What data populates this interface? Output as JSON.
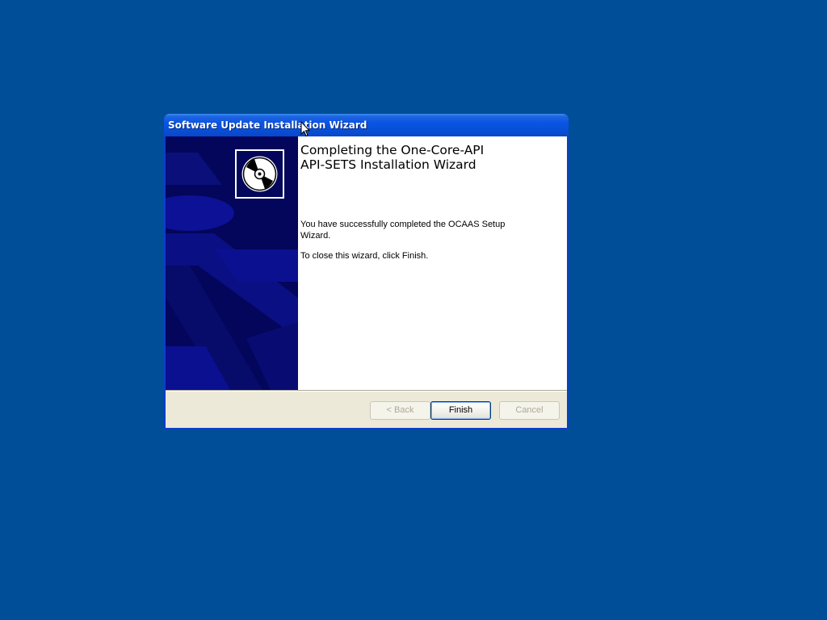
{
  "window": {
    "title": "Software Update Installation Wizard"
  },
  "wizard": {
    "heading_line1": "Completing the One-Core-API",
    "heading_line2": "API-SETS Installation Wizard",
    "message1": "You have successfully completed the OCAAS Setup Wizard.",
    "message2": "To close this wizard, click Finish.",
    "banner_icon": "cd-disc-icon"
  },
  "buttons": {
    "back": "< Back",
    "finish": "Finish",
    "cancel": "Cancel"
  },
  "colors": {
    "desktop": "#004e98",
    "titlebar": "#0a54e4",
    "banner": "#03065a",
    "dialog_face": "#ece9d8"
  }
}
